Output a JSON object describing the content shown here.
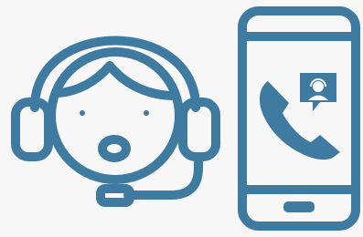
{
  "illustration": {
    "colors": {
      "stroke": "#3f7aa0",
      "background": "#f7f7f8"
    },
    "icons": [
      "support-agent-headset-icon",
      "smartphone-icon",
      "phone-handset-icon",
      "support-agent-badge-icon"
    ]
  }
}
